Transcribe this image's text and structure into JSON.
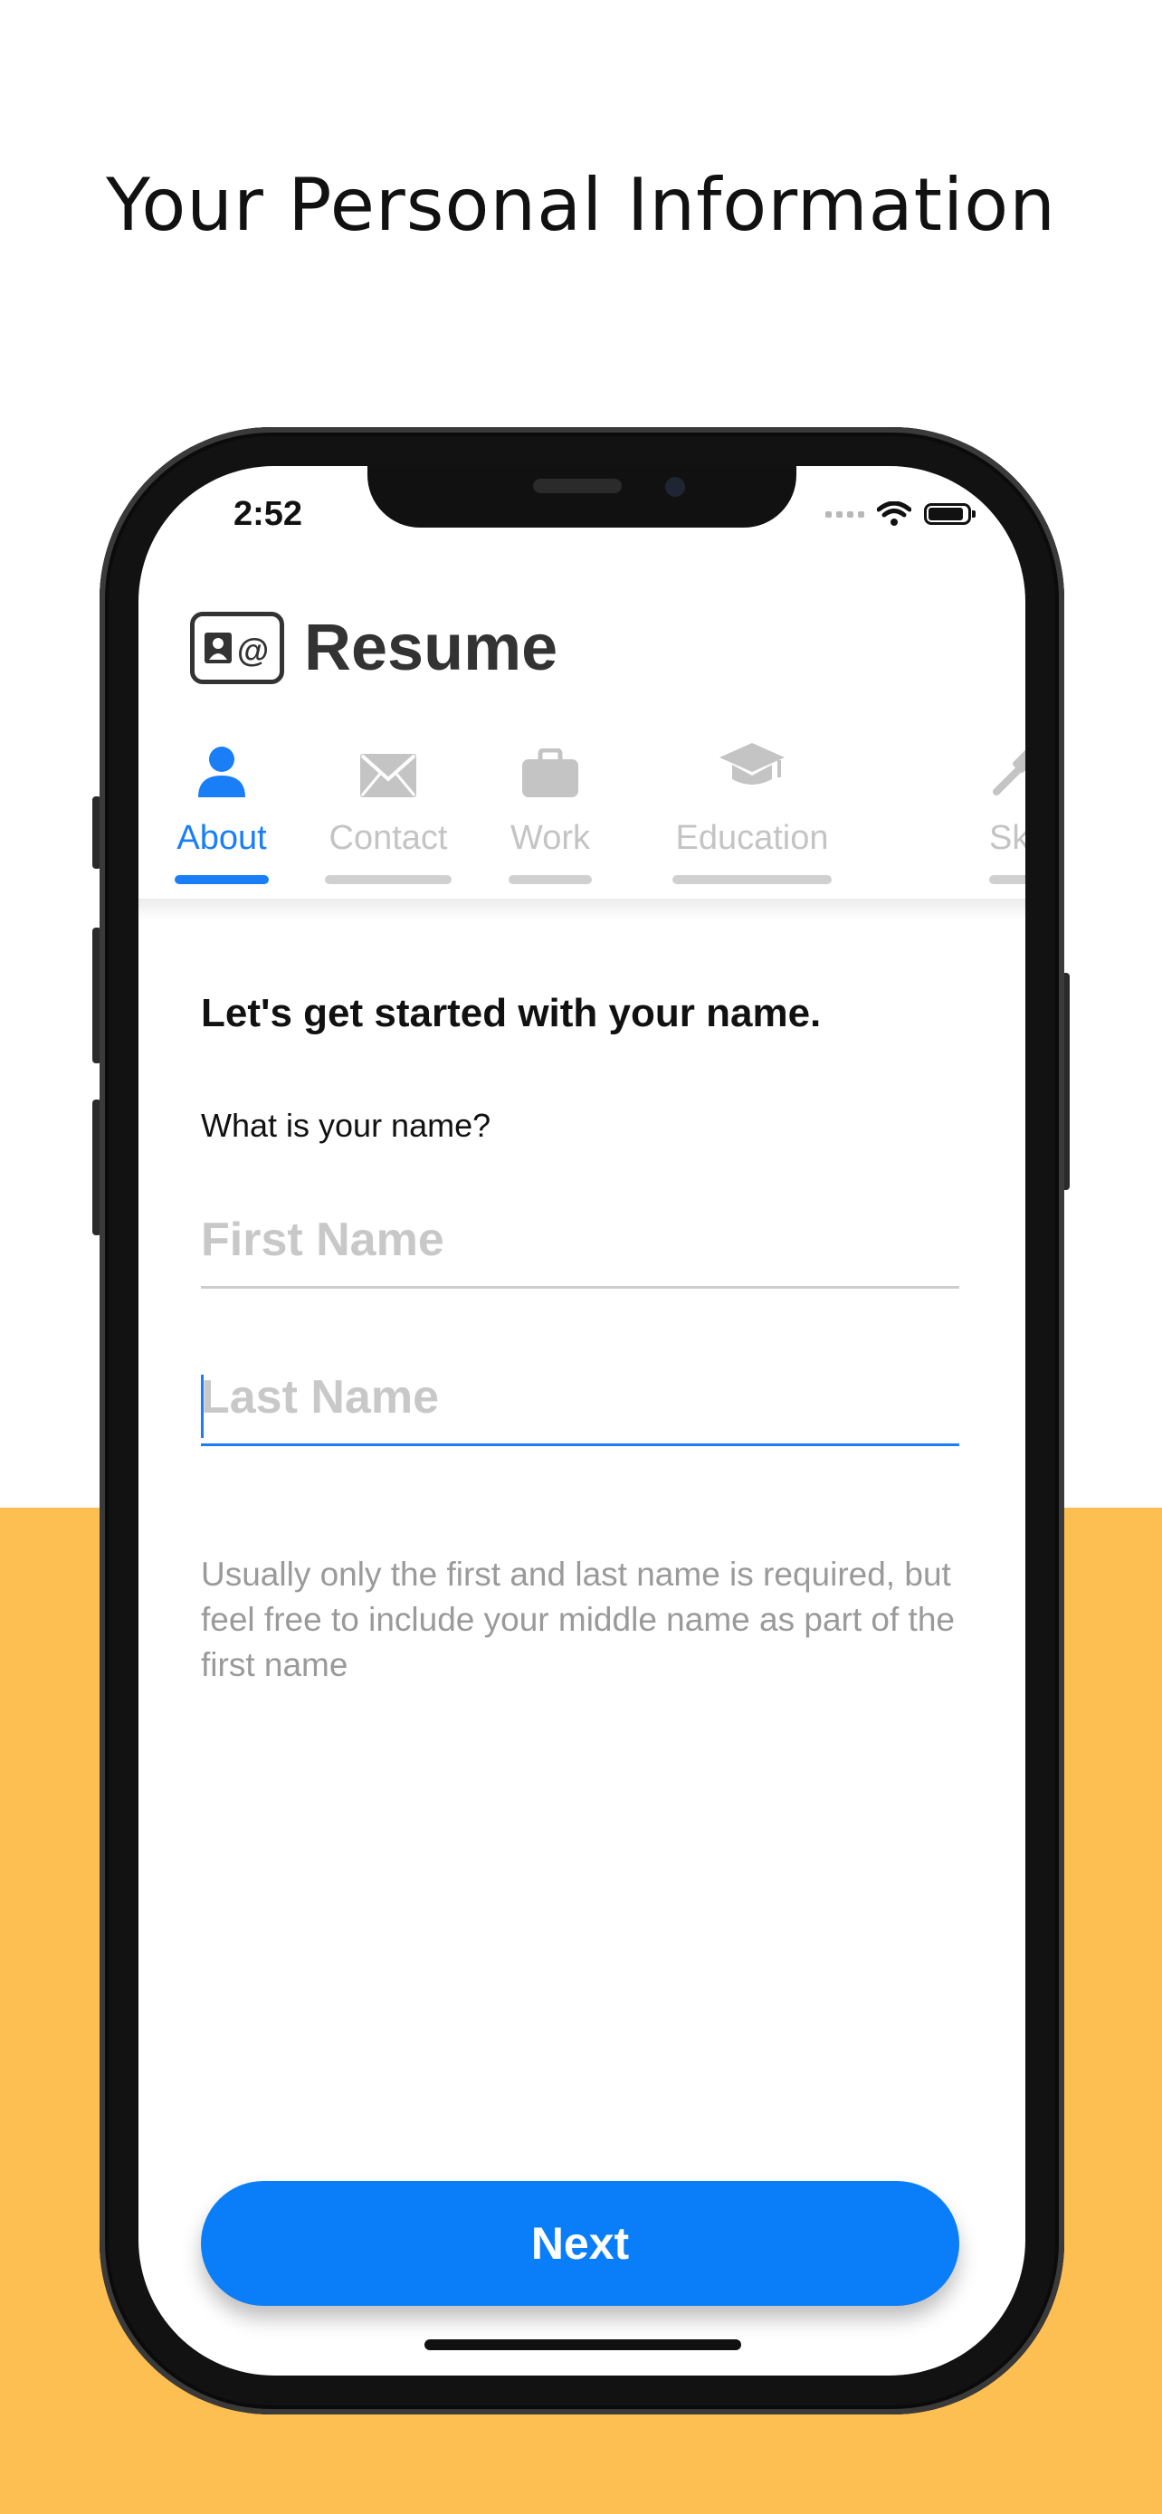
{
  "headline": "Your Personal Information",
  "status_bar": {
    "time": "2:52"
  },
  "app": {
    "title": "Resume"
  },
  "tabs": [
    {
      "label": "About",
      "icon": "person-icon",
      "active": true
    },
    {
      "label": "Contact",
      "icon": "envelope-icon",
      "active": false
    },
    {
      "label": "Work",
      "icon": "briefcase-icon",
      "active": false
    },
    {
      "label": "Education",
      "icon": "graduation-cap-icon",
      "active": false
    },
    {
      "label": "Sk",
      "icon": "hammer-icon",
      "active": false
    }
  ],
  "form": {
    "prompt": "Let's get started with your name.",
    "question": "What is your name?",
    "first_name": {
      "value": "",
      "placeholder": "First Name"
    },
    "last_name": {
      "value": "",
      "placeholder": "Last Name"
    },
    "hint": "Usually only the first and last name is required, but feel free to include your middle name as part of the first name"
  },
  "next_button": {
    "label": "Next"
  },
  "colors": {
    "accent": "#0A7EF8",
    "background_bottom": "#FDBF52",
    "inactive": "#C4C4C4"
  }
}
